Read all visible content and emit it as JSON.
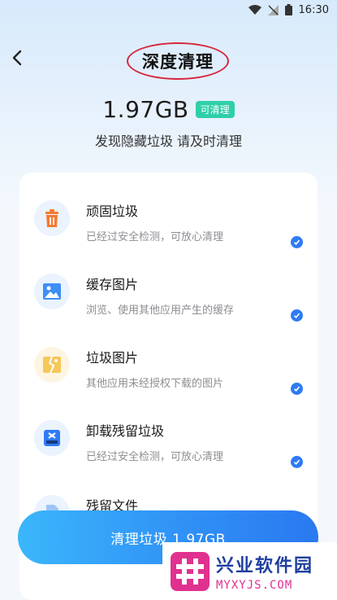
{
  "status_bar": {
    "time": "16:30"
  },
  "header": {
    "title": "深度清理"
  },
  "summary": {
    "size": "1.97GB",
    "badge": "可清理",
    "subtitle": "发现隐藏垃圾 请及时清理"
  },
  "items": [
    {
      "title": "顽固垃圾",
      "desc": "已经过安全检测，可放心清理",
      "icon": "trash-icon",
      "checked": true
    },
    {
      "title": "缓存图片",
      "desc": "浏览、使用其他应用产生的缓存",
      "icon": "image-icon",
      "checked": true
    },
    {
      "title": "垃圾图片",
      "desc": "其他应用未经授权下载的图片",
      "icon": "broken-image-icon",
      "checked": true
    },
    {
      "title": "卸载残留垃圾",
      "desc": "已经过安全检测，可放心清理",
      "icon": "uninstall-icon",
      "checked": true
    },
    {
      "title": "残留文件",
      "desc": "",
      "icon": "file-icon",
      "checked": true
    }
  ],
  "cta": {
    "label": "清理垃圾 1.97GB"
  },
  "watermark": {
    "name": "兴业软件园",
    "url": "MYXYJS.COM"
  },
  "colors": {
    "accent": "#2f7bf5",
    "badge": "#2ecfa8",
    "annotation": "#d7263d"
  }
}
